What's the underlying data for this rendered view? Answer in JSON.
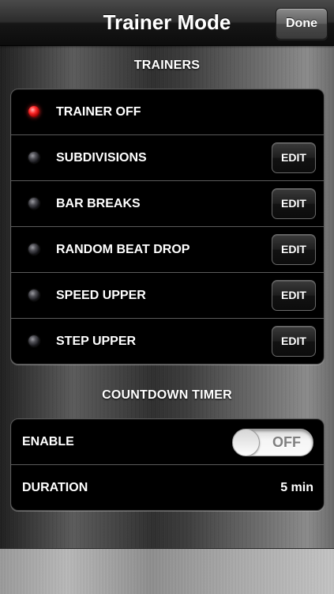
{
  "navbar": {
    "title": "Trainer Mode",
    "done_label": "Done"
  },
  "trainers": {
    "header": "TRAINERS",
    "edit_label": "EDIT",
    "items": [
      {
        "label": "TRAINER OFF",
        "active": true,
        "editable": false
      },
      {
        "label": "SUBDIVISIONS",
        "active": false,
        "editable": true
      },
      {
        "label": "BAR BREAKS",
        "active": false,
        "editable": true
      },
      {
        "label": "RANDOM BEAT DROP",
        "active": false,
        "editable": true
      },
      {
        "label": "SPEED UPPER",
        "active": false,
        "editable": true
      },
      {
        "label": "STEP UPPER",
        "active": false,
        "editable": true
      }
    ]
  },
  "countdown": {
    "header": "COUNTDOWN TIMER",
    "enable_label": "ENABLE",
    "enable_state": "OFF",
    "duration_label": "DURATION",
    "duration_value": "5 min"
  },
  "colors": {
    "led_on": "#ff2a2a",
    "led_off": "#4a4a50"
  },
  "icons": {
    "led_on": "red-led-indicator-icon",
    "led_off": "gray-led-indicator-icon"
  }
}
